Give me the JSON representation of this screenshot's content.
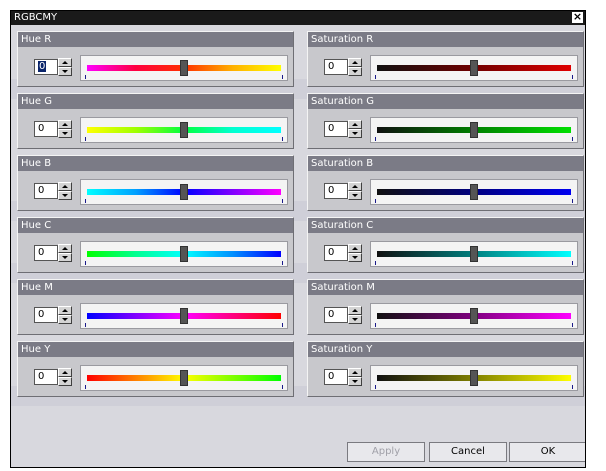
{
  "window": {
    "title": "RGBCMY"
  },
  "groups": [
    {
      "label": "Hue R",
      "value": "0",
      "gradient": [
        "#ff00ff",
        "#ff0040",
        "#ff3000",
        "#ffb000",
        "#ffff00"
      ]
    },
    {
      "label": "Saturation R",
      "value": "0",
      "gradient": [
        "#101010",
        "#700000",
        "#e00000"
      ]
    },
    {
      "label": "Hue G",
      "value": "0",
      "gradient": [
        "#ffff00",
        "#a0ff00",
        "#00ff40",
        "#00ffd0",
        "#00ffff"
      ]
    },
    {
      "label": "Saturation G",
      "value": "0",
      "gradient": [
        "#101010",
        "#008000",
        "#00e000"
      ]
    },
    {
      "label": "Hue B",
      "value": "0",
      "gradient": [
        "#00ffff",
        "#00a0ff",
        "#0000ff",
        "#8000ff",
        "#ff00ff"
      ]
    },
    {
      "label": "Saturation B",
      "value": "0",
      "gradient": [
        "#101010",
        "#000080",
        "#0000f0"
      ]
    },
    {
      "label": "Hue C",
      "value": "0",
      "gradient": [
        "#00ff00",
        "#00ff90",
        "#00ffff",
        "#0090ff",
        "#0000ff"
      ]
    },
    {
      "label": "Saturation C",
      "value": "0",
      "gradient": [
        "#101010",
        "#007f7f",
        "#00ffff"
      ]
    },
    {
      "label": "Hue M",
      "value": "0",
      "gradient": [
        "#0000ff",
        "#8000ff",
        "#ff00ff",
        "#ff0080",
        "#ff0000"
      ]
    },
    {
      "label": "Saturation M",
      "value": "0",
      "gradient": [
        "#101010",
        "#800080",
        "#ff00ff"
      ]
    },
    {
      "label": "Hue Y",
      "value": "0",
      "gradient": [
        "#ff0000",
        "#ff8000",
        "#ffff00",
        "#80ff00",
        "#00ff00"
      ]
    },
    {
      "label": "Saturation Y",
      "value": "0",
      "gradient": [
        "#101010",
        "#808000",
        "#ffff00"
      ]
    }
  ],
  "buttons": {
    "apply": "Apply",
    "cancel": "Cancel",
    "ok": "OK"
  }
}
